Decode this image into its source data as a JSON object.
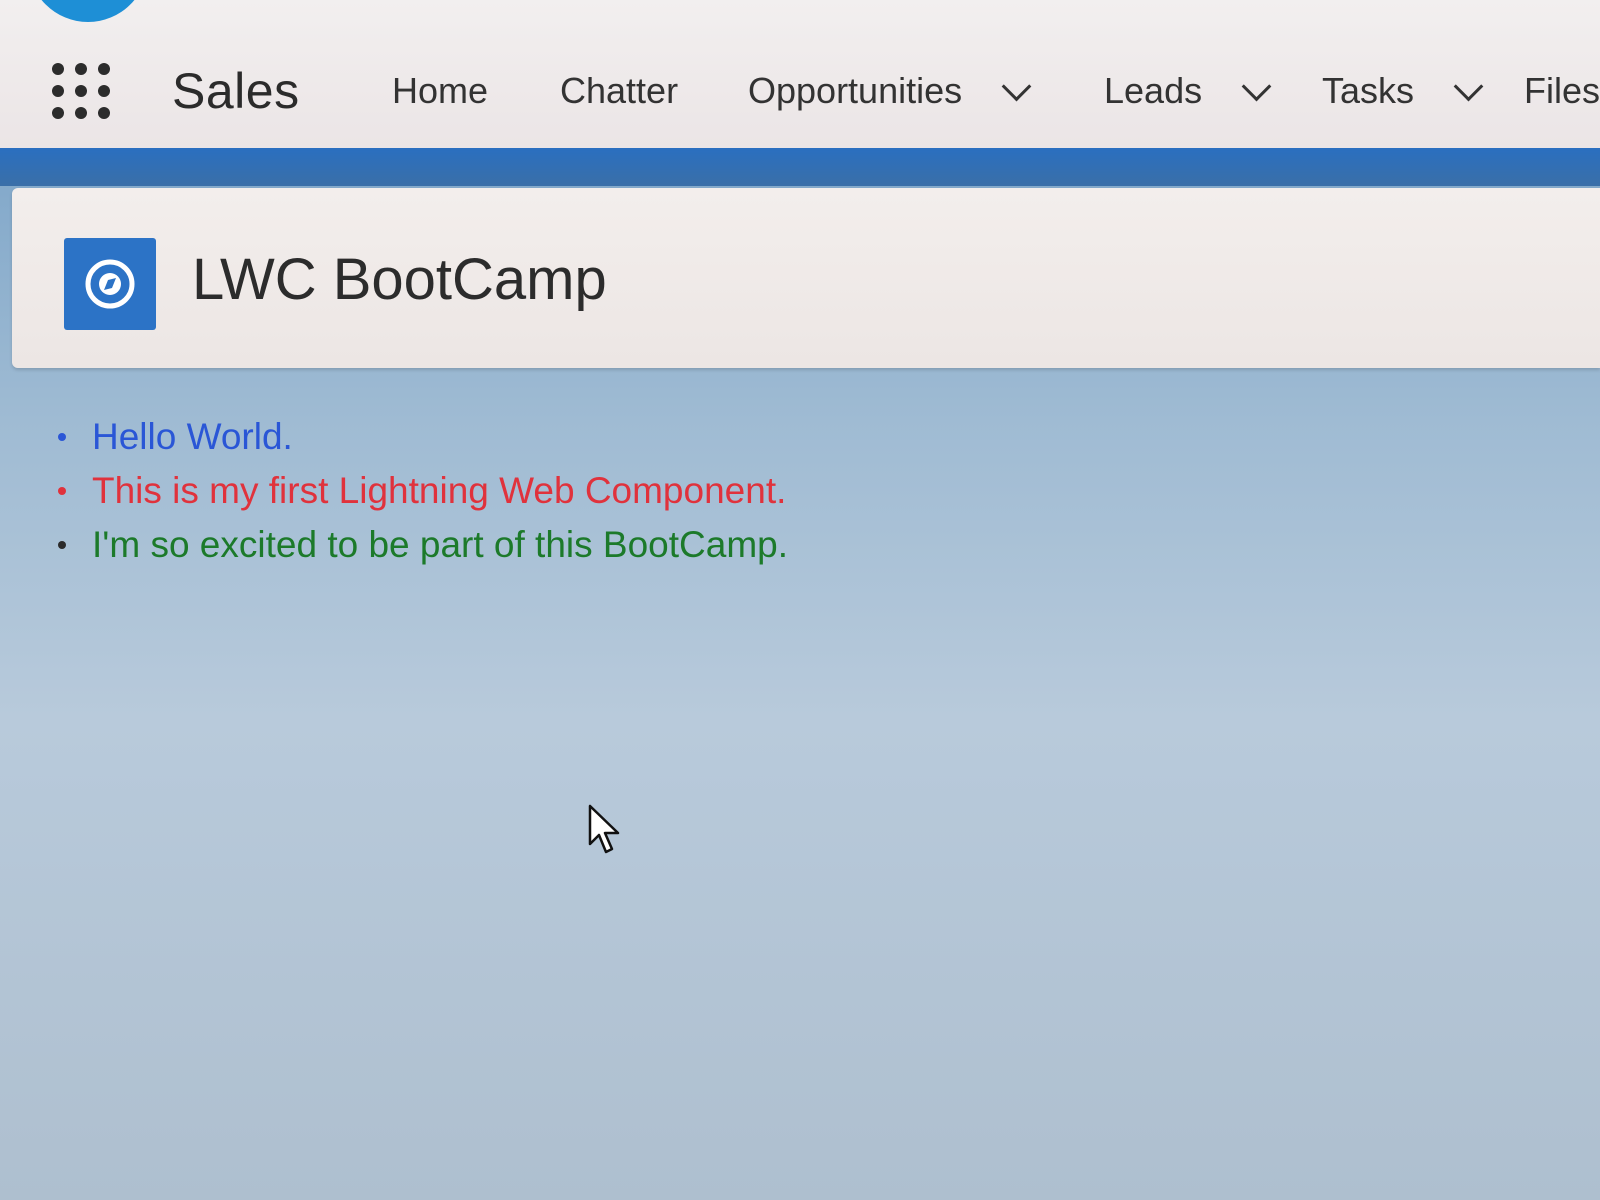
{
  "topbar": {
    "app_name": "Sales",
    "nav": [
      {
        "label": "Home",
        "has_dropdown": false
      },
      {
        "label": "Chatter",
        "has_dropdown": false
      },
      {
        "label": "Opportunities",
        "has_dropdown": true
      },
      {
        "label": "Leads",
        "has_dropdown": true
      },
      {
        "label": "Tasks",
        "has_dropdown": true
      },
      {
        "label": "Files",
        "has_dropdown": false
      }
    ],
    "app_launcher_icon": "waffle-grid-icon"
  },
  "page_header": {
    "title": "LWC BootCamp",
    "icon": "compass-icon"
  },
  "messages": [
    {
      "text": "Hello World.",
      "color": "#2a56d6"
    },
    {
      "text": "This is my first Lightning Web Component.",
      "color": "#e0323c"
    },
    {
      "text": "I'm so excited to be part of this BootCamp.",
      "color": "#1c7a2a"
    }
  ],
  "colors": {
    "brand_blue": "#2c73c6",
    "band_blue": "#2a6fc0",
    "background": "#a8c0d6"
  }
}
